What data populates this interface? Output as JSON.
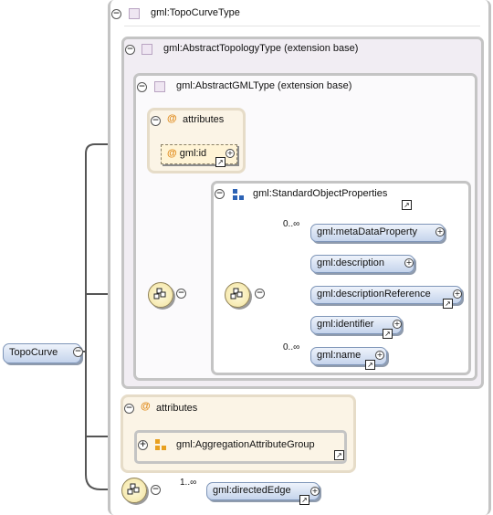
{
  "root": {
    "label": "TopoCurve"
  },
  "outer_type": {
    "label": "gml:TopoCurveType"
  },
  "abstract_topology": {
    "label": "gml:AbstractTopologyType (extension base)"
  },
  "abstract_gml": {
    "label": "gml:AbstractGMLType (extension base)"
  },
  "gml_attributes": {
    "header": "attributes",
    "attribute": "gml:id"
  },
  "standard_object_properties": {
    "label": "gml:StandardObjectProperties",
    "elements": [
      {
        "label": "gml:metaDataProperty",
        "occurrence": "0..∞"
      },
      {
        "label": "gml:description",
        "occurrence": ""
      },
      {
        "label": "gml:descriptionReference",
        "occurrence": ""
      },
      {
        "label": "gml:identifier",
        "occurrence": ""
      },
      {
        "label": "gml:name",
        "occurrence": "0..∞"
      }
    ]
  },
  "outer_attributes": {
    "header": "attributes",
    "group": "gml:AggregationAttributeGroup"
  },
  "directed_edge": {
    "label": "gml:directedEdge",
    "occurrence": "1..∞"
  },
  "colors": {
    "element_fill": "#c5d4ec",
    "attribute_fill": "#fbf4e6",
    "type_border": "#c4c4c4",
    "attribute_icon": "#e08a1a"
  }
}
